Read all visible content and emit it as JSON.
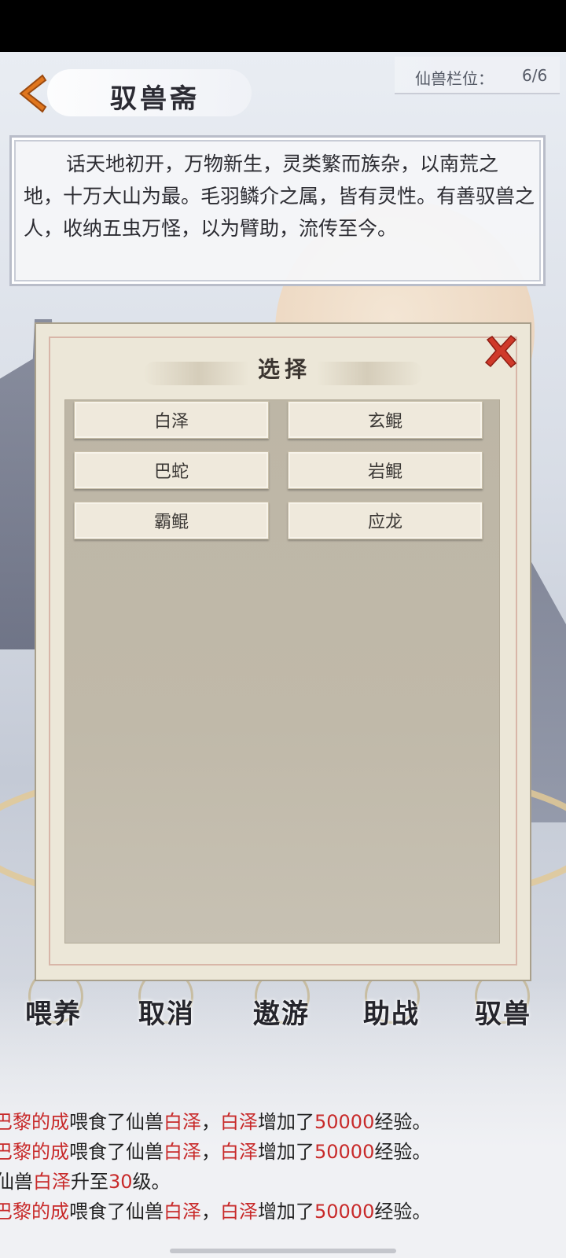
{
  "header": {
    "title": "驭兽斋",
    "slot_label": "仙兽栏位：",
    "slot_value": "6/6"
  },
  "description": "话天地初开，万物新生，灵类繁而族杂，以南荒之地，十万大山为最。毛羽鳞介之属，皆有灵性。有善驭兽之人，收纳五虫万怪，以为臂助，流传至今。",
  "modal": {
    "title": "选择",
    "beasts": [
      "白泽",
      "玄鲲",
      "巴蛇",
      "岩鲲",
      "霸鲲",
      "应龙"
    ]
  },
  "actions": [
    "喂养",
    "取消",
    "遨游",
    "助战",
    "驭兽"
  ],
  "log": [
    [
      {
        "text": "巴黎的成",
        "red": true
      },
      {
        "text": "喂食了仙兽",
        "red": false
      },
      {
        "text": "白泽",
        "red": true
      },
      {
        "text": "，",
        "red": false
      },
      {
        "text": "白泽",
        "red": true
      },
      {
        "text": "增加了",
        "red": false
      },
      {
        "text": "50000",
        "red": true
      },
      {
        "text": "经验。",
        "red": false
      }
    ],
    [
      {
        "text": "巴黎的成",
        "red": true
      },
      {
        "text": "喂食了仙兽",
        "red": false
      },
      {
        "text": "白泽",
        "red": true
      },
      {
        "text": "，",
        "red": false
      },
      {
        "text": "白泽",
        "red": true
      },
      {
        "text": "增加了",
        "red": false
      },
      {
        "text": "50000",
        "red": true
      },
      {
        "text": "经验。",
        "red": false
      }
    ],
    [
      {
        "text": "仙兽",
        "red": false
      },
      {
        "text": "白泽",
        "red": true
      },
      {
        "text": "升至",
        "red": false
      },
      {
        "text": "30",
        "red": true
      },
      {
        "text": "级。",
        "red": false
      }
    ],
    [
      {
        "text": "巴黎的成",
        "red": true
      },
      {
        "text": "喂食了仙兽",
        "red": false
      },
      {
        "text": "白泽",
        "red": true
      },
      {
        "text": "，",
        "red": false
      },
      {
        "text": "白泽",
        "red": true
      },
      {
        "text": "增加了",
        "red": false
      },
      {
        "text": "50000",
        "red": true
      },
      {
        "text": "经验。",
        "red": false
      }
    ]
  ],
  "colors": {
    "accent_orange": "#e0761e",
    "close_red": "#cf3a2a",
    "log_red": "#c82a2a"
  }
}
